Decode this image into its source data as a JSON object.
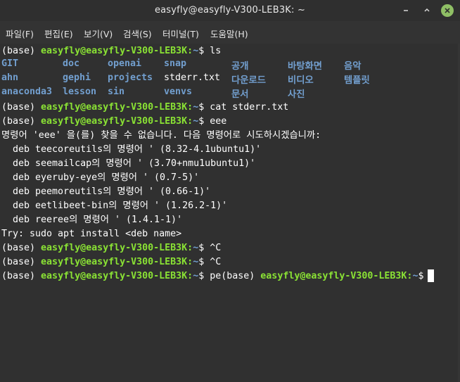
{
  "window": {
    "title": "easyfly@easyfly-V300-LEB3K: ~"
  },
  "menu": [
    "파일(F)",
    "편집(E)",
    "보기(V)",
    "검색(S)",
    "터미널(T)",
    "도움말(H)"
  ],
  "prompt": {
    "env": "(base) ",
    "userhost": "easyfly@easyfly-V300-LEB3K:",
    "path": "~",
    "symbol": "$ "
  },
  "commands": {
    "c1": "ls",
    "c2": "cat stderr.txt",
    "c3": "eee",
    "c4": "^C",
    "c5": "^C",
    "c6_prefix": "pe"
  },
  "ls": {
    "row1": [
      "GIT",
      "doc",
      "openai",
      "snap",
      "공개",
      "바탕화면",
      "음악"
    ],
    "row2": [
      "ahn",
      "gephi",
      "projects",
      "stderr.txt",
      "다운로드",
      "비디오",
      "템플릿"
    ],
    "row3": [
      "anaconda3",
      "lesson",
      "sin",
      "venvs",
      "문서",
      "사진"
    ]
  },
  "output": {
    "not_found": "명령어 'eee' 을(를) 찾을 수 없습니다. 다음 명령어로 시도하시겠습니까:",
    "suggestions": [
      "  deb teecoreutils의 명령어 ' (8.32-4.1ubuntu1)'",
      "  deb seemailcap의 명령어 ' (3.70+nmu1ubuntu1)'",
      "  deb eyeruby-eye의 명령어 ' (0.7-5)'",
      "  deb peemoreutils의 명령어 ' (0.66-1)'",
      "  deb eetlibeet-bin의 명령어 ' (1.26.2-1)'",
      "  deb reeree의 명령어 ' (1.4.1-1)'"
    ],
    "try": "Try: sudo apt install <deb name>"
  },
  "colors": {
    "background": "#303030",
    "prompt_userhost": "#8ae234",
    "directory": "#729fcf",
    "text": "#ffffff",
    "close_button": "#8fbf65"
  },
  "icons": [
    "minimize-icon",
    "maximize-icon",
    "close-icon"
  ]
}
